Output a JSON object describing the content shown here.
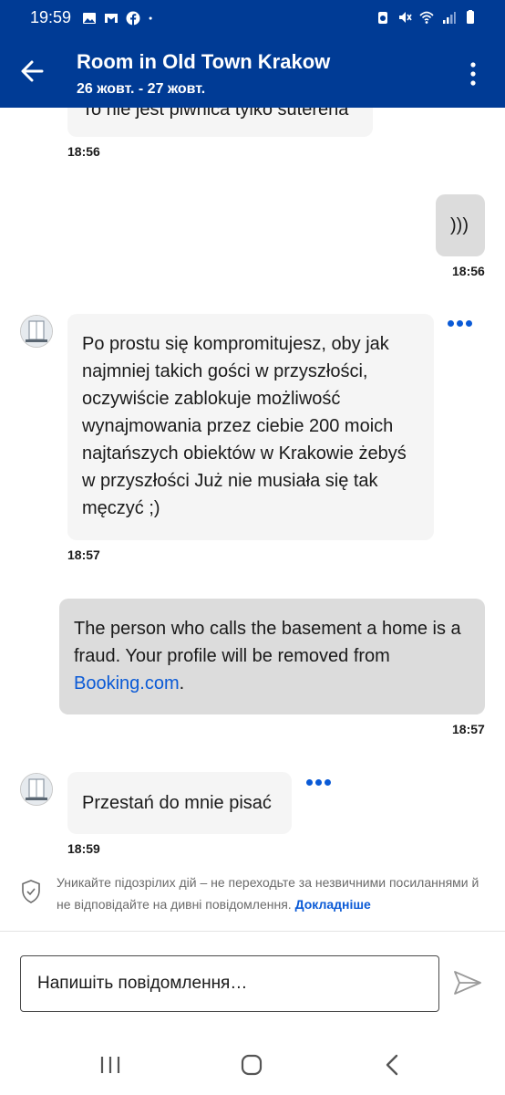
{
  "status_bar": {
    "time": "19:59",
    "left_icons": [
      "gallery-icon",
      "gmail-icon",
      "facebook-icon",
      "dot-icon"
    ],
    "right_icons": [
      "alarm-icon",
      "mute-icon",
      "wifi-icon",
      "signal-icon",
      "battery-icon"
    ]
  },
  "header": {
    "title": "Room in Old Town Krakow",
    "subtitle": "26 жовт. - 27 жовт.",
    "back_icon": "arrow-left-icon",
    "menu_icon": "more-vertical-icon"
  },
  "messages": [
    {
      "direction": "incoming",
      "text": "To nie jest piwnica tylko suterena",
      "time": "18:56",
      "avatar": false
    },
    {
      "direction": "outgoing",
      "text": ")))",
      "time": "18:56"
    },
    {
      "direction": "incoming",
      "avatar": true,
      "lines": [
        "Po prostu się kompromitujesz, oby jak",
        "najmniej takich gości w przyszłości,",
        "oczywiście zablokuje możliwość",
        "wynajmowania przez ciebie 200 moich",
        "najtańszych obiektów w Krakowie żebyś",
        "w przyszłości Już nie musiała się tak",
        "męczyć ;)"
      ],
      "time": "18:57"
    },
    {
      "direction": "outgoing",
      "line1": "The person who calls the basement a home is a",
      "line2": "fraud. Your profile will be removed from",
      "link": "Booking.com",
      "after_link": ".",
      "time": "18:57"
    },
    {
      "direction": "incoming",
      "avatar": true,
      "text": "Przestań do mnie pisać",
      "time": "18:59"
    }
  ],
  "notice": {
    "text": "Уникайте підозрілих дій – не переходьте за незвичними посиланнями й не відповідайте на дивні повідомлення.",
    "link": "Докладніше",
    "icon": "shield-check-icon"
  },
  "composer": {
    "placeholder": "Напишіть повідомлення…",
    "send_icon": "send-icon"
  },
  "nav": [
    "recents-icon",
    "home-icon",
    "back-chevron-icon"
  ],
  "colors": {
    "brand": "#003b95",
    "link": "#0a5ad6",
    "incoming_bubble": "#f5f5f5",
    "outgoing_bubble": "#dcdcdc"
  }
}
